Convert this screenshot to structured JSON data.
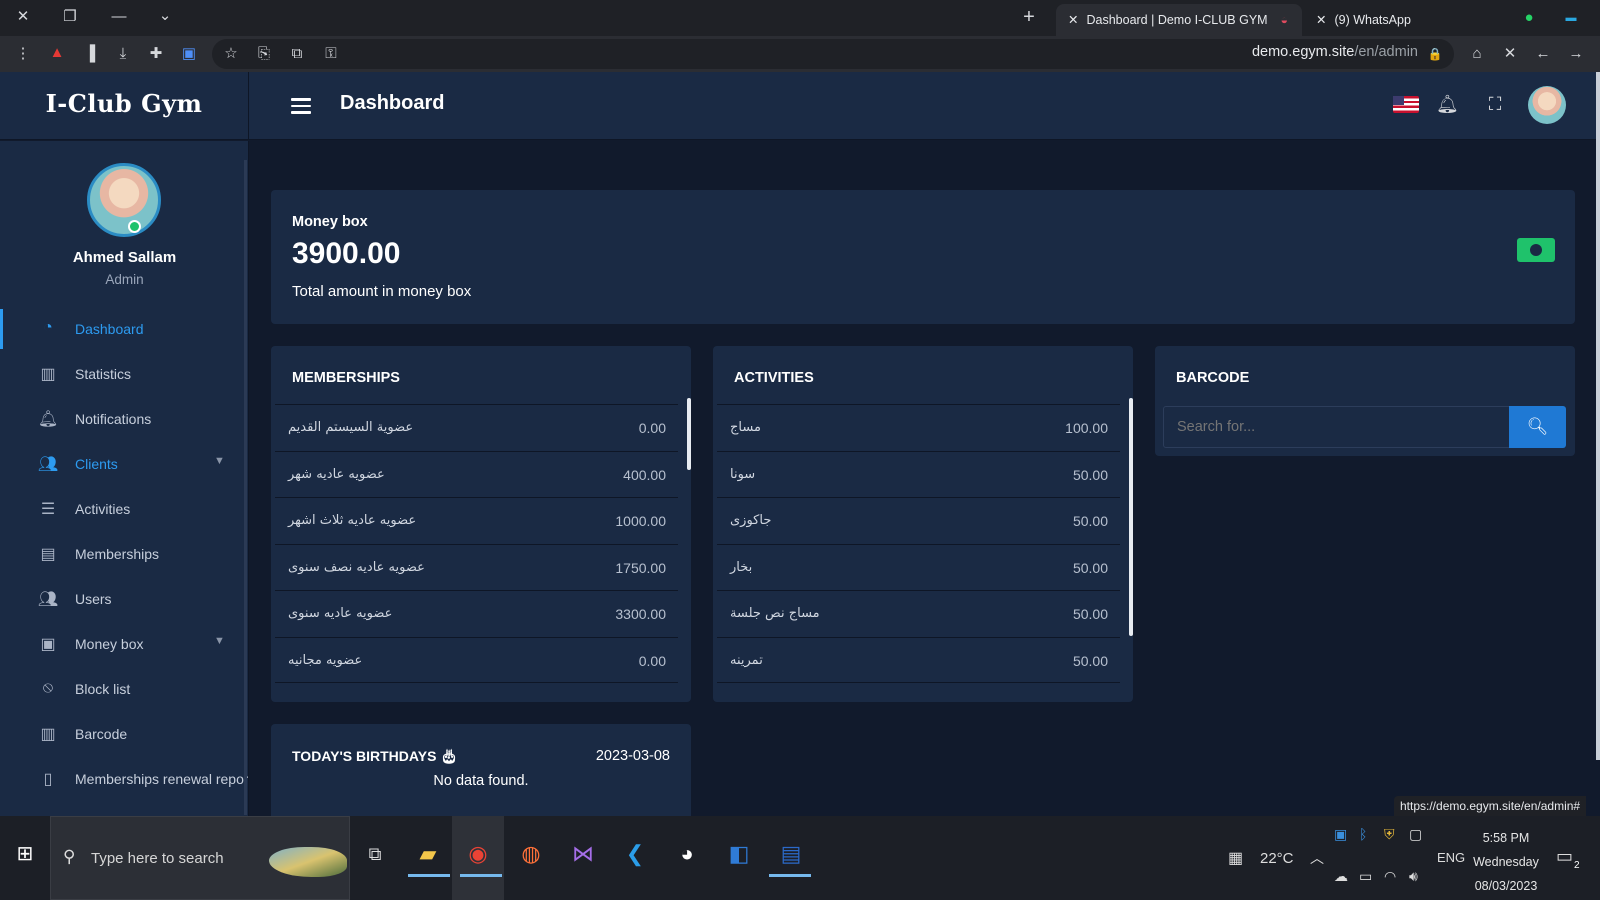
{
  "browser": {
    "tabs": [
      {
        "label": "Dashboard | Demo I-CLUB GYM",
        "active": true
      },
      {
        "label": "(9) WhatsApp",
        "active": false
      }
    ],
    "url_host": "demo.egym.site",
    "url_path": "/en/admin",
    "status_url": "https://demo.egym.site/en/admin#"
  },
  "app": {
    "brand": "I-Club Gym",
    "page_title": "Dashboard"
  },
  "user": {
    "name": "Ahmed Sallam",
    "role": "Admin"
  },
  "nav": [
    {
      "label": "Dashboard",
      "icon": "gauge-icon"
    },
    {
      "label": "Statistics",
      "icon": "bar-chart-icon"
    },
    {
      "label": "Notifications",
      "icon": "bell-icon"
    },
    {
      "label": "Clients",
      "icon": "users-icon"
    },
    {
      "label": "Activities",
      "icon": "list-icon"
    },
    {
      "label": "Memberships",
      "icon": "id-card-icon"
    },
    {
      "label": "Users",
      "icon": "users-icon"
    },
    {
      "label": "Money box",
      "icon": "money-icon"
    },
    {
      "label": "Block list",
      "icon": "ban-icon"
    },
    {
      "label": "Barcode",
      "icon": "barcode-icon"
    },
    {
      "label": "Memberships renewal repor",
      "icon": "file-icon"
    }
  ],
  "money_box": {
    "title": "Money box",
    "amount": "3900.00",
    "caption": "Total amount in money box"
  },
  "memberships": {
    "title": "MEMBERSHIPS",
    "rows": [
      {
        "name": "عضوية السيستم القديم",
        "value": "0.00"
      },
      {
        "name": "عضويه عاديه شهر",
        "value": "400.00"
      },
      {
        "name": "عضويه عاديه ثلاث اشهر",
        "value": "1000.00"
      },
      {
        "name": "عضويه عاديه نصف سنوى",
        "value": "1750.00"
      },
      {
        "name": "عضويه عاديه سنوى",
        "value": "3300.00"
      },
      {
        "name": "عضويه مجانيه",
        "value": "0.00"
      }
    ]
  },
  "activities": {
    "title": "ACTIVITIES",
    "rows": [
      {
        "name": "مساج",
        "value": "100.00"
      },
      {
        "name": "سونا",
        "value": "50.00"
      },
      {
        "name": "جاكوزى",
        "value": "50.00"
      },
      {
        "name": "بخار",
        "value": "50.00"
      },
      {
        "name": "مساج نص جلسة",
        "value": "50.00"
      },
      {
        "name": "تمرينه",
        "value": "50.00"
      }
    ]
  },
  "barcode": {
    "title": "BARCODE",
    "placeholder": "Search for..."
  },
  "birthdays": {
    "title": "TODAY'S BIRTHDAYS",
    "date": "2023-03-08",
    "empty": "No data found."
  },
  "taskbar": {
    "search_placeholder": "Type here to search",
    "weather": "22°C",
    "lang": "ENG",
    "time": "5:58 PM",
    "day": "Wednesday",
    "date": "08/03/2023",
    "notif_count": "2"
  },
  "colors": {
    "accent": "#2d9bf0",
    "card": "#1a2a44",
    "background": "#111a2c",
    "money_icon": "#1fc26b"
  }
}
